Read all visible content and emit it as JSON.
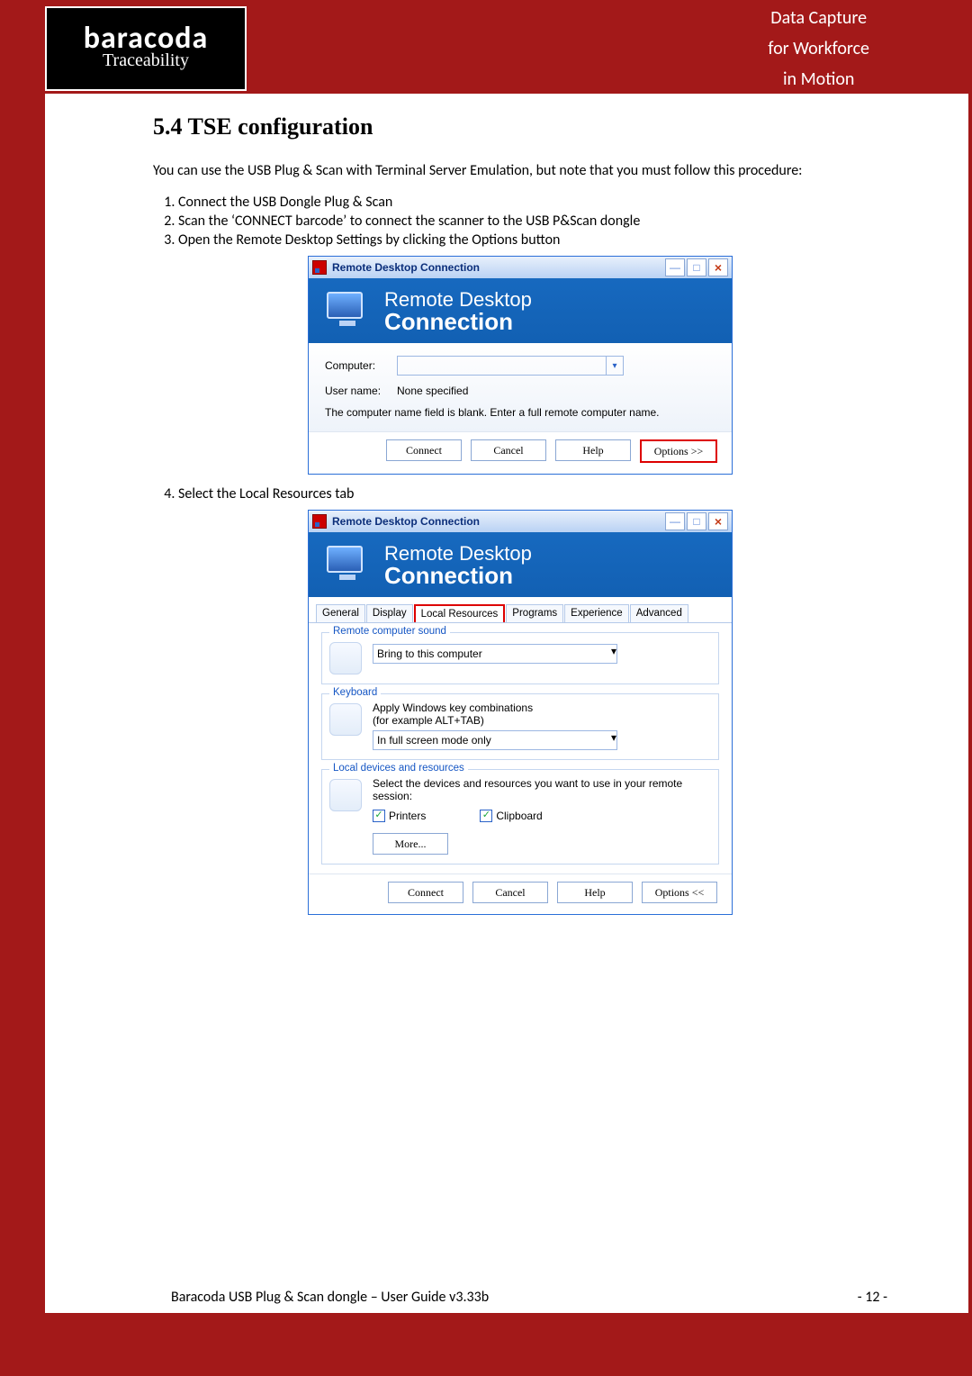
{
  "header": {
    "logo_main": "baracoda",
    "logo_sub": "Traceability",
    "tagline_l1": "Data Capture",
    "tagline_l2": "for Workforce",
    "tagline_l3": "in Motion"
  },
  "section_title": "5.4 TSE configuration",
  "intro": "You can use the USB Plug & Scan with Terminal Server Emulation, but note that you must follow this procedure:",
  "steps_a": [
    "Connect the USB Dongle Plug & Scan",
    "Scan the ‘CONNECT barcode’ to connect the scanner to the USB P&Scan dongle",
    "Open the Remote Desktop Settings by clicking the Options button"
  ],
  "steps_b": [
    "Select the Local Resources tab"
  ],
  "rdc": {
    "title": "Remote Desktop Connection",
    "banner_l1": "Remote Desktop",
    "banner_l2": "Connection",
    "computer_lbl": "Computer:",
    "computer_value": "",
    "username_lbl": "User name:",
    "username_value": "None specified",
    "hint": "The computer name field is blank. Enter a full remote computer name.",
    "btn_connect": "Connect",
    "btn_cancel": "Cancel",
    "btn_help": "Help",
    "btn_options_expand": "Options >>",
    "btn_options_collapse": "Options <<",
    "tabs": [
      "General",
      "Display",
      "Local Resources",
      "Programs",
      "Experience",
      "Advanced"
    ],
    "sound": {
      "legend": "Remote computer sound",
      "value": "Bring to this computer"
    },
    "keyboard": {
      "legend": "Keyboard",
      "desc_l1": "Apply Windows key combinations",
      "desc_l2": "(for example ALT+TAB)",
      "value": "In full screen mode only"
    },
    "local": {
      "legend": "Local devices and resources",
      "desc": "Select the devices and resources you want to use in your remote session:",
      "printers": "Printers",
      "clipboard": "Clipboard",
      "more": "More..."
    }
  },
  "footer": {
    "left": "Baracoda USB Plug & Scan dongle – User Guide v3.33b",
    "right": "- 12 -"
  }
}
